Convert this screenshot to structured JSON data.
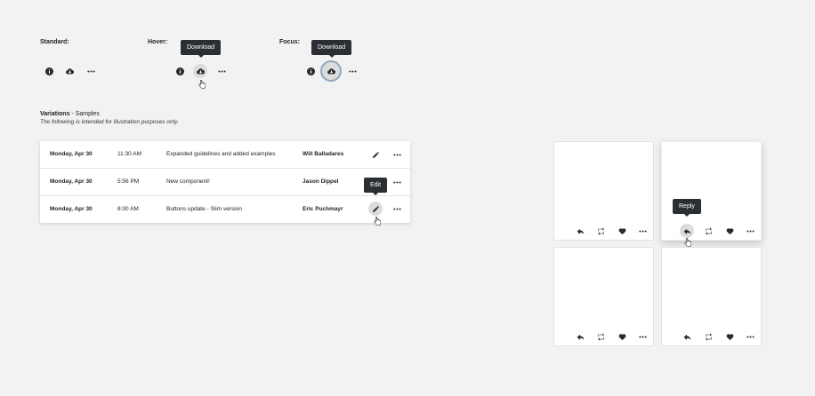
{
  "states": {
    "standard": {
      "label": "Standard:"
    },
    "hover": {
      "label": "Hover:",
      "tooltip": "Download"
    },
    "focus": {
      "label": "Focus:",
      "tooltip": "Download"
    }
  },
  "variations": {
    "title_bold": "Variations",
    "title_rest": " - Samples",
    "subtitle": "The following is intended for illustration purposes only."
  },
  "table": {
    "rows": [
      {
        "date": "Monday, Apr 30",
        "time": "11:30 AM",
        "description": "Expanded guidelines and added examples",
        "author": "Will Balladares"
      },
      {
        "date": "Monday, Apr 30",
        "time": "5:56 PM",
        "description": "New component!",
        "author": "Jason Dippel"
      },
      {
        "date": "Monday, Apr 30",
        "time": "8:00 AM",
        "description": "Buttons update - Slim version",
        "author": "Eric Puchmayr"
      }
    ],
    "edit_tooltip": "Edit"
  },
  "cards": {
    "reply_tooltip": "Reply"
  },
  "icons": {
    "info": "info-icon",
    "download": "cloud-download-icon",
    "more": "more-horizontal-icon",
    "edit": "pencil-icon",
    "reply": "reply-icon",
    "retweet": "retweet-icon",
    "like": "heart-icon",
    "cursor": "hand-pointer-icon"
  },
  "colors": {
    "background": "#f2f2f2",
    "tooltip": "#2b2f33",
    "focus_ring": "#8fa7bd",
    "icon": "#2a2a2a"
  }
}
